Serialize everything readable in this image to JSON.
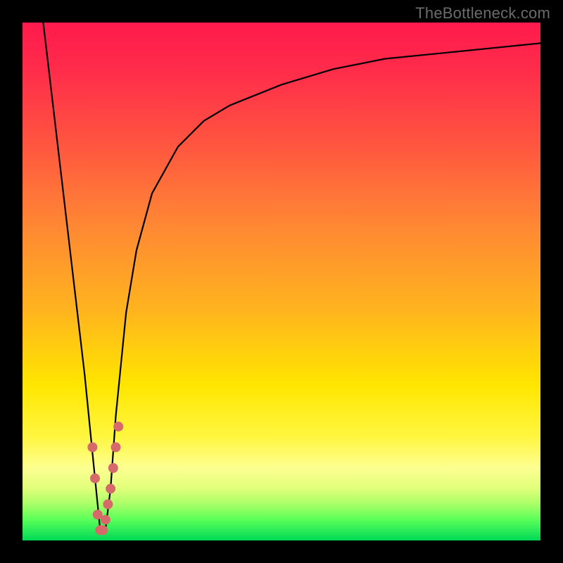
{
  "watermark": "TheBottleneck.com",
  "colors": {
    "frame": "#000000",
    "gradient_stops": [
      {
        "offset": 0.0,
        "color": "#ff1a4d"
      },
      {
        "offset": 0.1,
        "color": "#ff2e4a"
      },
      {
        "offset": 0.25,
        "color": "#ff5a3f"
      },
      {
        "offset": 0.4,
        "color": "#ff8a33"
      },
      {
        "offset": 0.55,
        "color": "#ffb21f"
      },
      {
        "offset": 0.7,
        "color": "#ffe600"
      },
      {
        "offset": 0.8,
        "color": "#fff640"
      },
      {
        "offset": 0.86,
        "color": "#fdff91"
      },
      {
        "offset": 0.9,
        "color": "#e0ff7a"
      },
      {
        "offset": 0.93,
        "color": "#a8ff66"
      },
      {
        "offset": 0.96,
        "color": "#59ff59"
      },
      {
        "offset": 1.0,
        "color": "#00d956"
      }
    ],
    "curve": "#000000",
    "markers": "#d66a6a"
  },
  "chart_data": {
    "type": "line",
    "title": "",
    "xlabel": "",
    "ylabel": "",
    "xlim": [
      0,
      100
    ],
    "ylim": [
      0,
      100
    ],
    "note": "No axes, ticks, or numeric labels are visible; values below are estimated from pixel positions on a 0-100 normalized domain/range.",
    "series": [
      {
        "name": "curve",
        "x": [
          4,
          6,
          8,
          10,
          12,
          14,
          15,
          16,
          17,
          18,
          20,
          22,
          25,
          30,
          35,
          40,
          50,
          60,
          70,
          80,
          90,
          100
        ],
        "y": [
          100,
          83,
          66,
          49,
          32,
          12,
          2,
          2,
          10,
          24,
          44,
          56,
          67,
          76,
          81,
          84,
          88,
          91,
          93,
          94,
          95,
          96
        ]
      },
      {
        "name": "markers-left",
        "x": [
          13.5,
          14.0,
          14.5,
          15.0
        ],
        "y": [
          18,
          12,
          5,
          2
        ]
      },
      {
        "name": "markers-right",
        "x": [
          15.5,
          16.0,
          16.5,
          17.0,
          17.5,
          18.0,
          18.5
        ],
        "y": [
          2,
          4,
          7,
          10,
          14,
          18,
          22
        ]
      }
    ]
  }
}
